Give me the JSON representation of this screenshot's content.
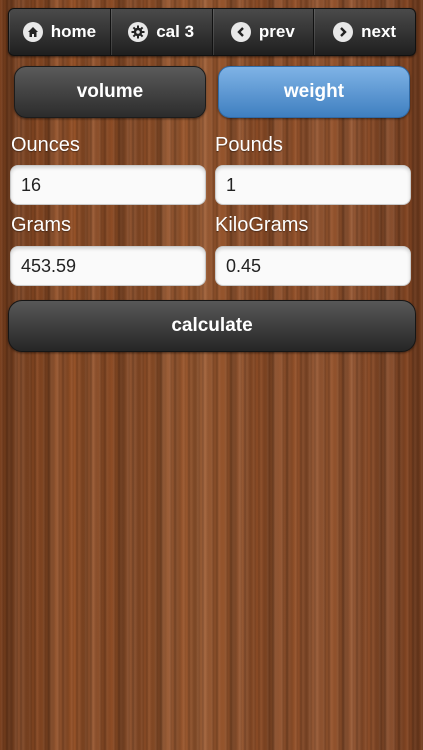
{
  "nav": {
    "items": [
      {
        "label": "home",
        "icon": "home-icon"
      },
      {
        "label": "cal 3",
        "icon": "gear-icon"
      },
      {
        "label": "prev",
        "icon": "chevron-left-icon"
      },
      {
        "label": "next",
        "icon": "chevron-right-icon"
      }
    ]
  },
  "toggles": {
    "volume_label": "volume",
    "weight_label": "weight",
    "active": "weight"
  },
  "fields": {
    "ounces": {
      "label": "Ounces",
      "value": "16"
    },
    "pounds": {
      "label": "Pounds",
      "value": "1"
    },
    "grams": {
      "label": "Grams",
      "value": "453.59"
    },
    "kilograms": {
      "label": "KiloGrams",
      "value": "0.45"
    }
  },
  "calculate_label": "calculate",
  "colors": {
    "active_toggle": "#4f8fd0",
    "dark_button": "#2c2c2c",
    "wood": "#9a5429"
  }
}
